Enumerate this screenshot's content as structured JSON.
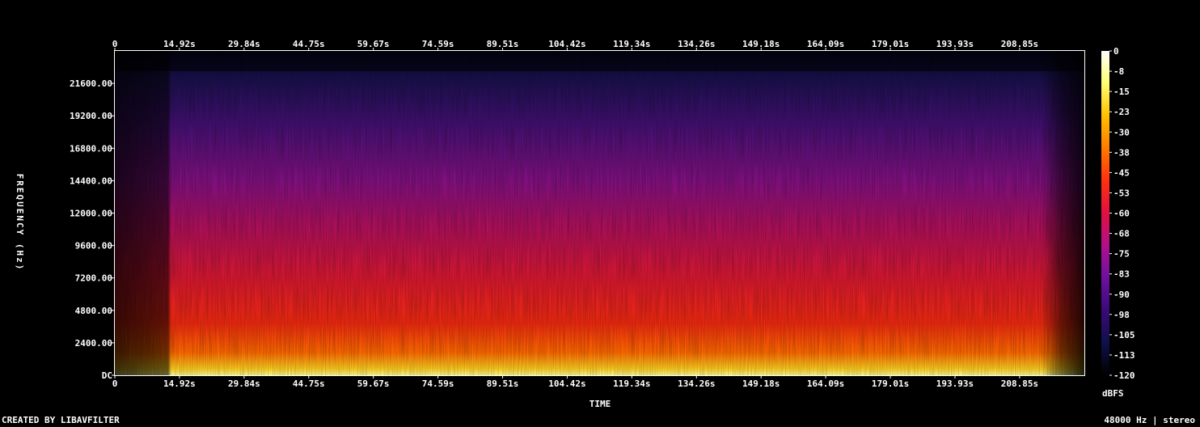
{
  "chart_data": {
    "type": "heatmap",
    "subtype": "spectrogram",
    "xlabel": "TIME",
    "ylabel": "FREQUENCY (Hz)",
    "x_ticks": [
      "0",
      "14.92s",
      "29.84s",
      "44.75s",
      "59.67s",
      "74.59s",
      "89.51s",
      "104.42s",
      "119.34s",
      "134.26s",
      "149.18s",
      "164.09s",
      "179.01s",
      "193.93s",
      "208.85s"
    ],
    "x_tick_values": [
      0,
      14.92,
      29.84,
      44.75,
      59.67,
      74.59,
      89.51,
      104.42,
      119.34,
      134.26,
      149.18,
      164.09,
      179.01,
      193.93,
      208.85
    ],
    "xlim": [
      0,
      223.8
    ],
    "y_ticks": [
      "DC",
      "2400.00",
      "4800.00",
      "7200.00",
      "9600.00",
      "12000.00",
      "14400.00",
      "16800.00",
      "19200.00",
      "21600.00"
    ],
    "y_tick_values": [
      0,
      2400,
      4800,
      7200,
      9600,
      12000,
      14400,
      16800,
      19200,
      21600
    ],
    "ylim": [
      0,
      24000
    ],
    "colorbar": {
      "label": "dBFS",
      "ticks": [
        "0",
        "-8",
        "-15",
        "-23",
        "-30",
        "-38",
        "-45",
        "-53",
        "-60",
        "-68",
        "-75",
        "-83",
        "-90",
        "-98",
        "-105",
        "-113",
        "-120"
      ],
      "range": [
        -120,
        0
      ],
      "colors": [
        "#000000",
        "#10104a",
        "#3a0a78",
        "#6e10a0",
        "#b0108c",
        "#e01040",
        "#ff3010",
        "#ff7a00",
        "#ffc000",
        "#ffff70",
        "#ffffff"
      ]
    },
    "footer_left": "CREATED BY LIBAVFILTER",
    "footer_right": "48000 Hz | stereo"
  }
}
